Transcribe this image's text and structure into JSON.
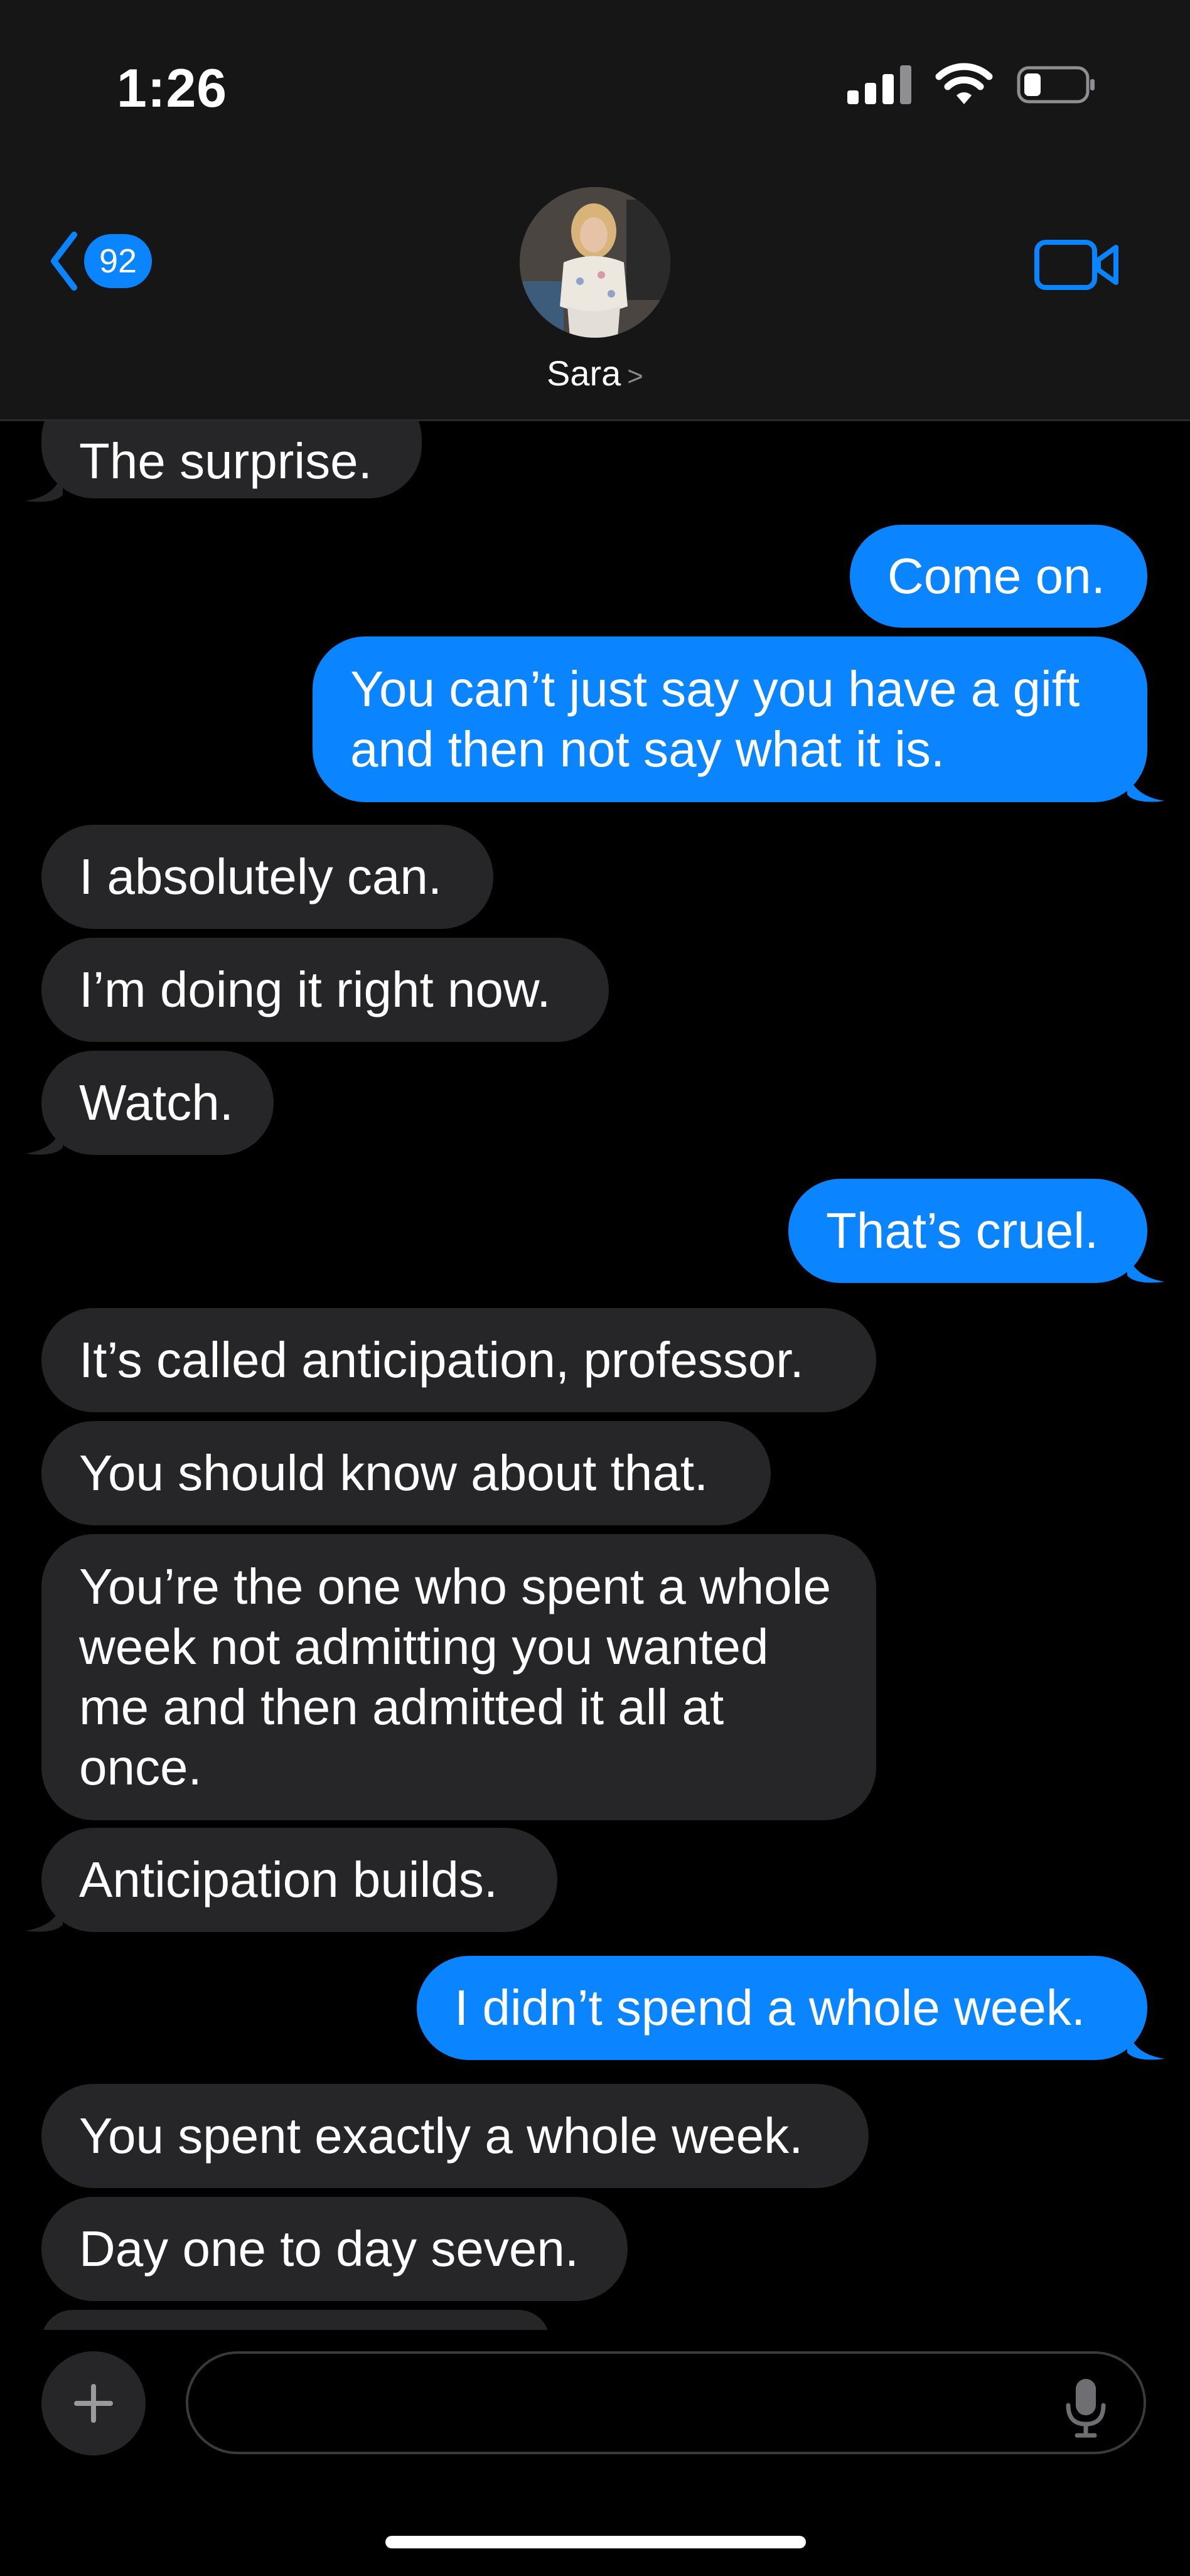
{
  "status_bar": {
    "time": "1:26"
  },
  "header": {
    "back_badge": "92",
    "contact_name": "Sara"
  },
  "messages": [
    {
      "side": "in",
      "text": "The surprise."
    },
    {
      "side": "out",
      "text": "Come on."
    },
    {
      "side": "out",
      "text": "You can’t just say you have a gift and then not say what it is."
    },
    {
      "side": "in",
      "text": "I absolutely can."
    },
    {
      "side": "in",
      "text": "I’m doing it right now."
    },
    {
      "side": "in",
      "text": "Watch."
    },
    {
      "side": "out",
      "text": "That’s cruel."
    },
    {
      "side": "in",
      "text": "It’s called anticipation, professor."
    },
    {
      "side": "in",
      "text": "You should know about that."
    },
    {
      "side": "in",
      "text": "You’re the one who spent a whole week not admitting you wanted me and then admitted it all at once."
    },
    {
      "side": "in",
      "text": "Anticipation builds."
    },
    {
      "side": "out",
      "text": "I didn’t spend a whole week."
    },
    {
      "side": "in",
      "text": "You spent exactly a whole week."
    },
    {
      "side": "in",
      "text": "Day one to day seven."
    }
  ],
  "composer": {
    "placeholder": ""
  },
  "colors": {
    "outgoing": "#0a84ff",
    "incoming": "#262628",
    "background": "#000000"
  }
}
